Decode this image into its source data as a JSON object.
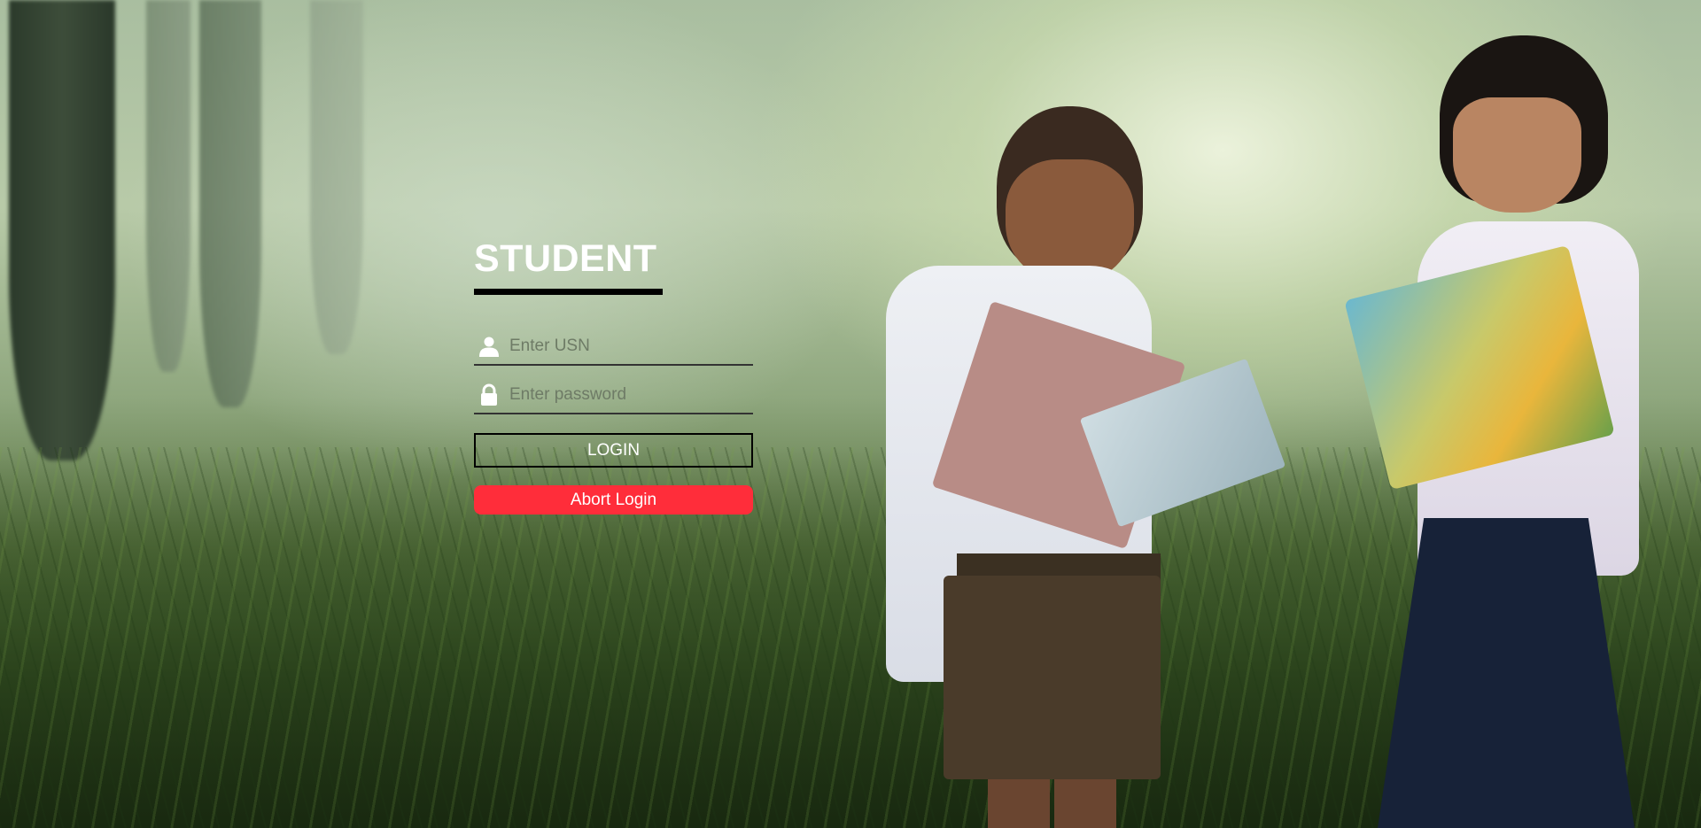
{
  "login": {
    "title": "STUDENT",
    "usn": {
      "icon": "user-icon",
      "placeholder": "Enter USN",
      "value": ""
    },
    "password": {
      "icon": "lock-icon",
      "placeholder": "Enter password",
      "value": ""
    },
    "login_label": "LOGIN",
    "abort_label": "Abort Login"
  },
  "colors": {
    "title": "#ffffff",
    "underline": "#000000",
    "abort_button": "#ff2d3a",
    "login_border": "#000000"
  }
}
